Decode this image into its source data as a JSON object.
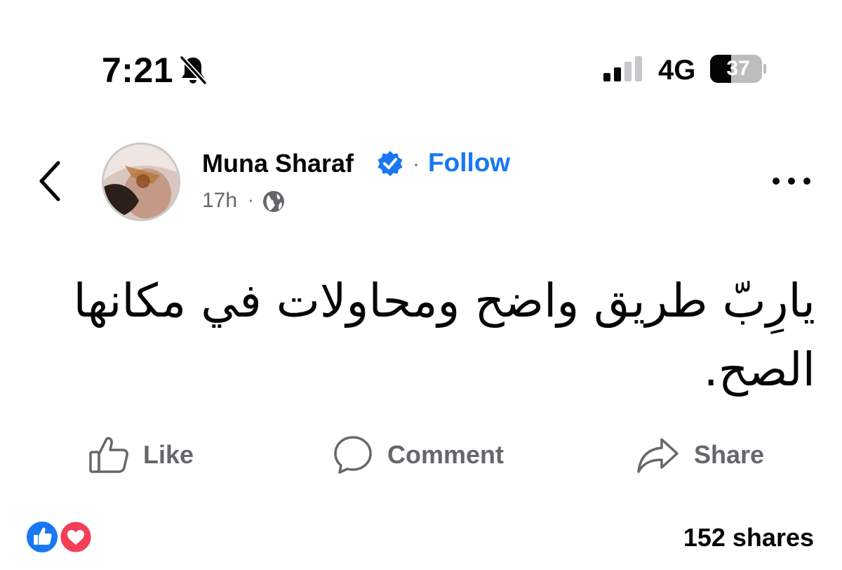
{
  "status_bar": {
    "time": "7:21",
    "network": "4G",
    "battery_level": "37"
  },
  "post": {
    "author": "Muna Sharaf",
    "follow_label": "Follow",
    "time_ago": "17h",
    "separator": "·",
    "text": "يارِبّ طريق واضح ومحاولات في مكانها الصح."
  },
  "actions": {
    "like": "Like",
    "comment": "Comment",
    "share": "Share"
  },
  "footer": {
    "shares": "152 shares"
  },
  "colors": {
    "accent": "#1877f2",
    "secondary_text": "#65676b",
    "love": "#f33e58"
  },
  "icons": [
    "bell-slash-icon",
    "signal-icon",
    "battery-icon",
    "back-chevron-icon",
    "verified-badge-icon",
    "globe-icon",
    "more-icon",
    "like-icon",
    "comment-icon",
    "share-icon",
    "like-reaction-icon",
    "love-reaction-icon"
  ]
}
